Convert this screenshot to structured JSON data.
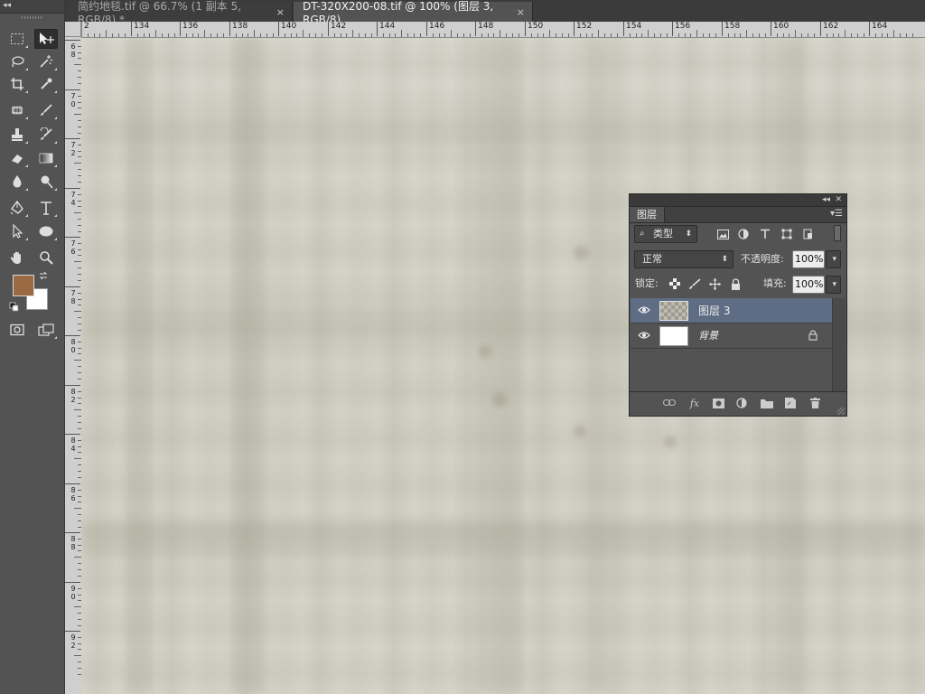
{
  "toolbar": {
    "collapse_icon": "collapse-arrows-icon",
    "foreground_color": "#9a6a44",
    "background_color": "#ffffff"
  },
  "tabs": [
    {
      "title": "简约地毯.tif @ 66.7% (1 副本 5, RGB/8) *",
      "active": false
    },
    {
      "title": "DT-320X200-08.tif @ 100% (图层 3, RGB/8)",
      "active": true
    }
  ],
  "tab_close_glyph": "×",
  "rulers": {
    "horizontal_labels": [
      "2",
      "134",
      "136",
      "138",
      "140",
      "142",
      "144",
      "146",
      "148",
      "150",
      "152",
      "154",
      "156",
      "158",
      "160",
      "162",
      "164"
    ],
    "vertical_labels": [
      "6 8",
      "7 0",
      "7 2",
      "7 4",
      "7 6",
      "7 8",
      "8 0",
      "8 2",
      "8 4",
      "8 6",
      "8 8",
      "9 0",
      "9 2"
    ]
  },
  "layers_panel": {
    "tab_label": "图层",
    "filter_label": "类型",
    "blend_mode": "正常",
    "opacity_label": "不透明度:",
    "opacity_value": "100%",
    "lock_label": "锁定:",
    "fill_label": "填充:",
    "fill_value": "100%",
    "layers": [
      {
        "name": "图层 3",
        "selected": true,
        "italic": false,
        "locked": false
      },
      {
        "name": "背景",
        "selected": false,
        "italic": true,
        "locked": true
      }
    ],
    "footer_fx": "fx"
  }
}
